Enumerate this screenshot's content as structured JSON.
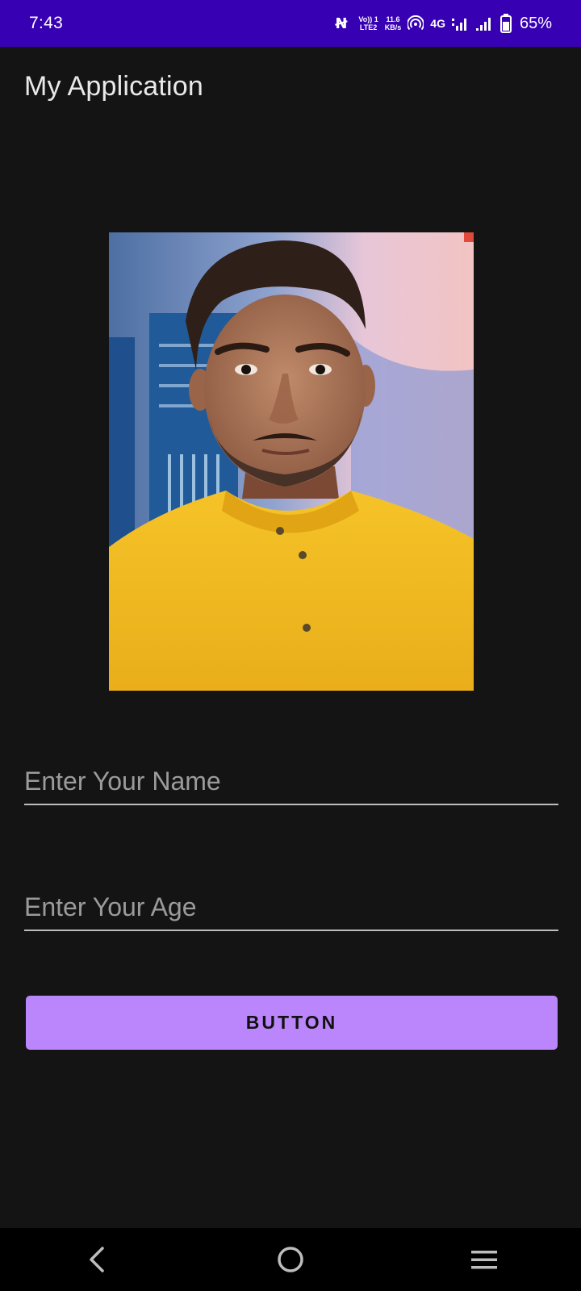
{
  "status_bar": {
    "time": "7:43",
    "volte_top": "Vo)) 1",
    "volte_bottom": "LTE2",
    "speed_value": "11.6",
    "speed_unit": "KB/s",
    "network": "4G",
    "battery_percent": "65%",
    "background_color": "#3700B3"
  },
  "app": {
    "title": "My Application"
  },
  "photo": {
    "icon": "profile-photo"
  },
  "form": {
    "name_placeholder": "Enter Your Name",
    "name_value": "",
    "age_placeholder": "Enter Your Age",
    "age_value": "",
    "button_label": "BUTTON",
    "button_color": "#BB86FC"
  },
  "nav": {
    "back_icon": "back-icon",
    "home_icon": "home-icon",
    "menu_icon": "menu-icon"
  }
}
